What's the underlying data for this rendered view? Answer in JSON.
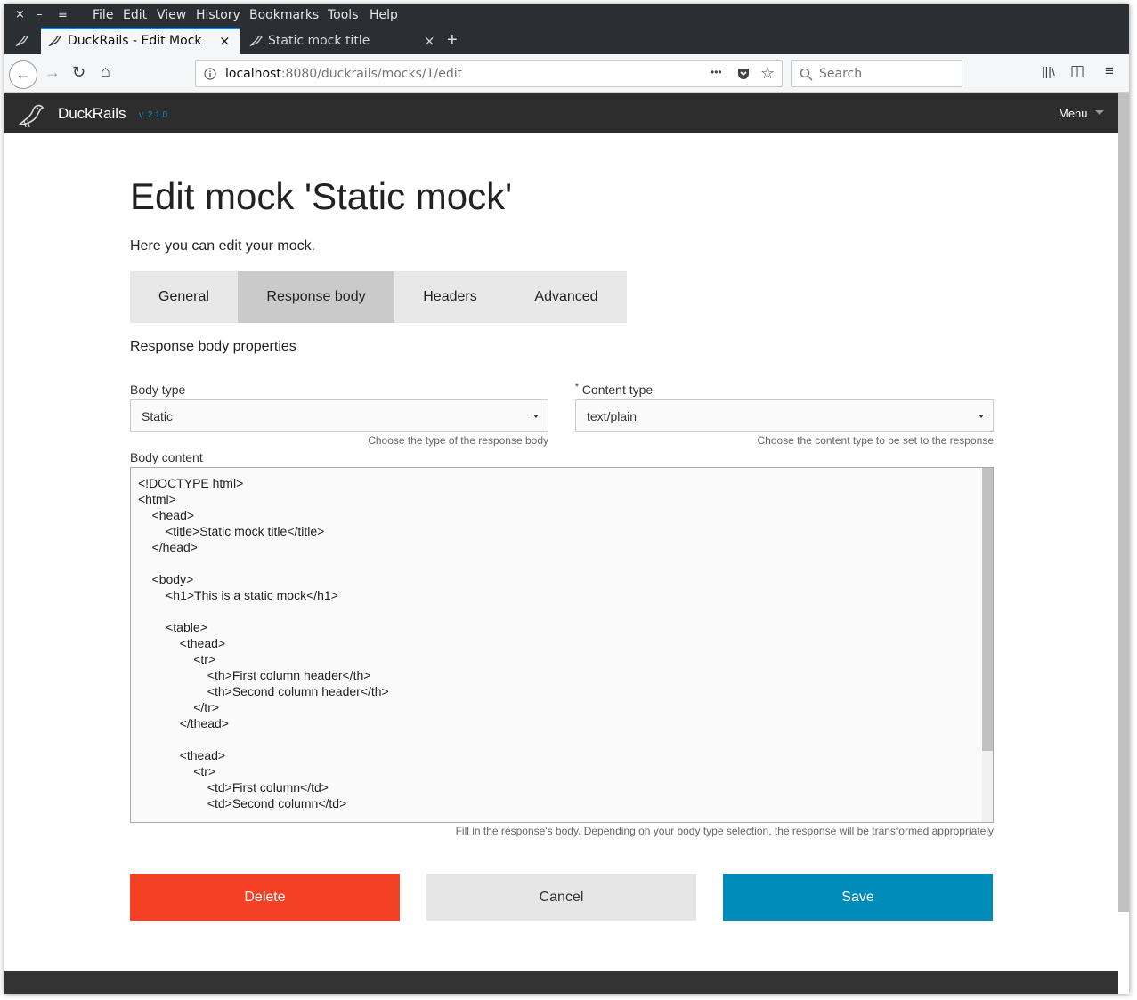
{
  "window": {
    "controls": {
      "close": "×",
      "minimize": "–",
      "menu": "≡"
    },
    "menu": [
      "File",
      "Edit",
      "View",
      "History",
      "Bookmarks",
      "Tools",
      "Help"
    ]
  },
  "tabs": [
    {
      "title": "DuckRails - Edit Mock",
      "active": true,
      "close": "×"
    },
    {
      "title": "Static mock title",
      "active": false,
      "close": "×"
    }
  ],
  "new_tab": "+",
  "nav": {
    "back": "←",
    "forward": "→",
    "reload": "↻",
    "home": "⌂",
    "url_host": "localhost",
    "url_rest": ":8080/duckrails/mocks/1/edit",
    "page_actions": "•••",
    "star": "☆",
    "search_placeholder": "Search",
    "library": "|||\\",
    "sidebar": "◫",
    "menu": "≡"
  },
  "app": {
    "brand": "DuckRails",
    "version": "v. 2.1.0",
    "menu_label": "Menu"
  },
  "page": {
    "title": "Edit mock 'Static mock'",
    "subtitle": "Here you can edit your mock.",
    "tabs": [
      "General",
      "Response body",
      "Headers",
      "Advanced"
    ],
    "section_title": "Response body properties",
    "body_type": {
      "label": "Body type",
      "value": "Static",
      "hint": "Choose the type of the response body"
    },
    "content_type": {
      "required_mark": "*",
      "label": "Content type",
      "value": "text/plain",
      "hint": "Choose the content type to be set to the response"
    },
    "body_content": {
      "label": "Body content",
      "text": "<!DOCTYPE html>\n<html>\n    <head>\n        <title>Static mock title</title>\n    </head>\n\n    <body>\n        <h1>This is a static mock</h1>\n\n        <table>\n            <thead>\n                <tr>\n                    <th>First column header</th>\n                    <th>Second column header</th>\n                </tr>\n            </thead>\n\n            <thead>\n                <tr>\n                    <td>First column</td>\n                    <td>Second column</td>",
      "hint": "Fill in the response's body. Depending on your body type selection, the response will be transformed appropriately"
    },
    "buttons": {
      "delete": "Delete",
      "cancel": "Cancel",
      "save": "Save"
    }
  },
  "colors": {
    "delete": "#f44025",
    "cancel": "#e6e6e6",
    "save": "#008cba",
    "appbar": "#2d2d2d",
    "version": "#0f8fbd"
  }
}
